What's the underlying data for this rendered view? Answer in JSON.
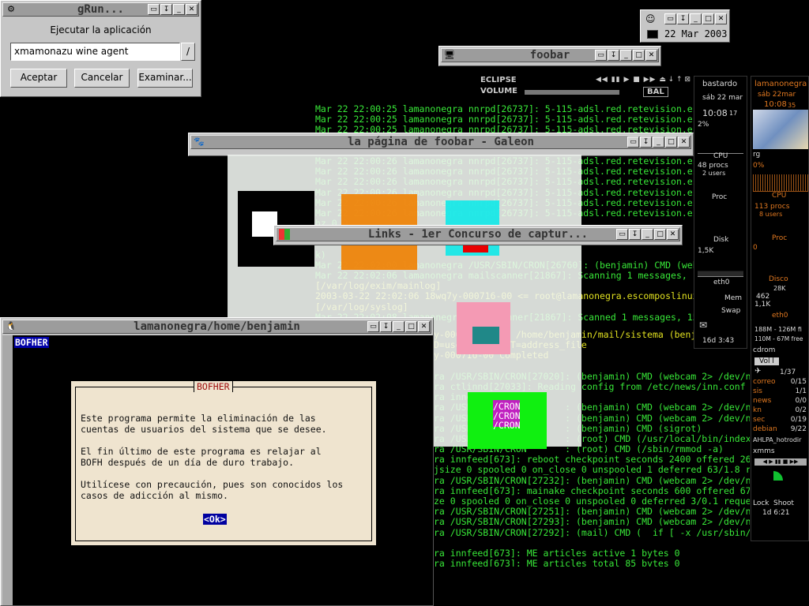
{
  "grun": {
    "title": "gRun...",
    "heading": "Ejecutar la aplicación",
    "input_value": "xmamonazu wine agent",
    "buttons": [
      "Aceptar",
      "Cancelar",
      "Examinar..."
    ]
  },
  "clock_win": {
    "date": "22 Mar 2003"
  },
  "foobar_win": {
    "title": "foobar",
    "player_name": "ECLIPSE",
    "volume_label": "VOLUME",
    "balance_label": "BAL"
  },
  "galeon_win": {
    "title": "la página de foobar - Galeon"
  },
  "links_win": {
    "title": "Links - 1er Concurso de captur..."
  },
  "term_win": {
    "title": "lamanonegra/home/benjamin",
    "program": "BOFHER",
    "dialog": {
      "title": "BOFHER",
      "lines": [
        "Este programa permite la eliminación de las",
        "cuentas de usuarios del sistema que se desee.",
        "",
        "El fin último de este programa es relajar al",
        "BOFH después de un día de duro trabajo.",
        "",
        "Utilícese con precaución, pues son conocidos los",
        "casos de adicción al mismo."
      ],
      "ok_label": "<Ok>"
    }
  },
  "log_lines": [
    {
      "text": "Mar 22 22:00:25 lamanonegra nnrpd[26737]: 5-115-adsl.red.retevision.es group es.",
      "color": "#38e838"
    },
    {
      "text": "Mar 22 22:00:25 lamanonegra nnrpd[26737]: 5-115-adsl.red.retevision.es group es.",
      "color": "#38e838"
    },
    {
      "text": "Mar 22 22:00:25 lamanonegra nnrpd[26737]: 5-115-adsl.red.retevision.es group es.",
      "color": "#38e838"
    },
    {
      "text": "Mar 22 22:00:25 lamanonegra nnrpd[26737]: 5-115-adsl.red.retevision.es group es.",
      "color": "#38e838"
    },
    {
      "text": "",
      "color": "#38e838"
    },
    {
      "text": "Mar 22 22:00:26 lamanonegra nnrpd[26737]: 5-115-adsl.red.retevision.es group es.",
      "color": "#38e838"
    },
    {
      "text": "Mar 22 22:00:26 lamanonegra nnrpd[26737]: 5-115-adsl.red.retevision.es group eco",
      "color": "#38e838"
    },
    {
      "text": "Mar 22 22:00:26 lamanonegra nnrpd[26737]: 5-115-adsl.red.retevision.es exit arti",
      "color": "#38e838"
    },
    {
      "text": "Mar 22 22:00:26 lamanonegra nnrpd[26737]: 5-115-adsl.red.retevision.es times use",
      "color": "#38e838"
    },
    {
      "text": "Mar 22 22:00:26 lamanonegra nnrpd[26737]: 5-115-adsl.red.retevision.es artstats",
      "color": "#38e838"
    },
    {
      "text": "Mar 22 22:00:26 lamanonegra nnrpd[26737]: 5-115-adsl.red.retevision.es overstats",
      "color": "#38e838"
    },
    {
      "text": "hz 0 0",
      "color": "#38e838"
    },
    {
      "text": "",
      "color": "#38e838"
    },
    {
      "text": "",
      "color": "#38e838"
    },
    {
      "text": "k)",
      "color": "#38e838"
    },
    {
      "text": "Mar 22 22:02:00 lamanonegra /USR/SBIN/CRON[26760]: (benjamin) CMD (webcam 2> /de",
      "color": "#38e838"
    },
    {
      "text": "Mar 22 22:02:06 lamanonegra mailscanner[21867]: Scanning 1 messages, 1579 bytes",
      "color": "#38e838"
    },
    {
      "text": "[/var/log/exim/mainlog]",
      "color": "#e0e020"
    },
    {
      "text": "2003-03-22 22:02:06 18wq7y-000716-00 <= root@lamanonegra.escomposlinux.org U=roo",
      "color": "#e0e020"
    },
    {
      "text": "[/var/log/syslog]",
      "color": "#e0e020"
    },
    {
      "text": "Mar 22 22:02:08 lamanonegra mailscanner[21867]: Scanned 1 messages, 1579 bytes i",
      "color": "#38e838"
    }
  ],
  "log_lines_lower": [
    {
      "text": "y-000716-00 => /home/benjamin/mail/sistema (benjamin@la",
      "color": "#e0e020"
    },
    {
      "text": "D=userforward T=address_file",
      "color": "#e0e020"
    },
    {
      "text": "y-000716-00 Completed",
      "color": "#e0e020"
    },
    {
      "text": "",
      "color": "#38e838"
    },
    {
      "text": "ra /USR/SBIN/CRON[27020]: (benjamin) CMD (webcam 2> /dev/null)",
      "color": "#38e838"
    },
    {
      "text": "ra ctlinnd[27033]: Reading config from /etc/news/inn.conf",
      "color": "#38e838"
    },
    {
      "text": "ra innd:",
      "color": "#38e838"
    },
    {
      "text": "ra /USR/                : (benjamin) CMD (webcam 2> /dev/null)",
      "color": "#38e838"
    },
    {
      "text": "ra /USR/                : (benjamin) CMD (webcam 2> /dev/null)",
      "color": "#38e838"
    },
    {
      "text": "ra /USR/                : (benjamin) CMD (sigrot)",
      "color": "#38e838"
    },
    {
      "text": "ra /USR/                : (root) CMD (/usr/local/bin/indexnews 1>/",
      "color": "#38e838"
    },
    {
      "text": "ra /USR/SBIN/CRON       : (root) CMD (/sbin/rmmod -a)",
      "color": "#38e838"
    },
    {
      "text": "ra innfeed[673]: reboot checkpoint seconds 2400 offered 261 accept",
      "color": "#38e838"
    },
    {
      "text": "jsize 0 spooled 0 on_close 0 unspooled 1 deferred 63/1.8 requeued",
      "color": "#38e838"
    },
    {
      "text": "ra /USR/SBIN/CRON[27232]: (benjamin) CMD (webcam 2> /dev/null)",
      "color": "#38e838"
    },
    {
      "text": "ra innfeed[673]: mainake checkpoint seconds 600 offered 67 accepte",
      "color": "#38e838"
    },
    {
      "text": "ze 0 spooled 0 on_close 0 unspooled 0 deferred 3/0.1 requeued 0 qu",
      "color": "#38e838"
    },
    {
      "text": "ra /USR/SBIN/CRON[27251]: (benjamin) CMD (webcam 2> /dev/null)",
      "color": "#38e838"
    },
    {
      "text": "ra /USR/SBIN/CRON[27293]: (benjamin) CMD (webcam 2> /dev/null)",
      "color": "#38e838"
    },
    {
      "text": "ra /USR/SBIN/CRON[27292]: (mail) CMD (  if [ -x /usr/sbin/exim -a -f /etc/exim/",
      "color": "#38e838"
    },
    {
      "text": "",
      "color": "#38e838"
    },
    {
      "text": "ra innfeed[673]: ME articles active 1 bytes 0",
      "color": "#38e838"
    },
    {
      "text": "ra innfeed[673]: ME articles total 85 bytes 0",
      "color": "#38e838"
    }
  ],
  "cron_labels": [
    "/CRON",
    "/CRON",
    "/CRON"
  ],
  "monitor1": {
    "host": "bastardo",
    "date": "sáb 22 mar",
    "time": "10:08",
    "time_sec": "17",
    "pct": "2%",
    "cpu_label": "CPU",
    "procs": "48 procs",
    "users": "2 users",
    "proc_label": "Proc",
    "disk_label": "Disk",
    "disk_val": "1,5K",
    "eth_label": "eth0",
    "mem_label": "Mem",
    "swap_label": "Swap",
    "uptime": "16d 3:43"
  },
  "monitor2": {
    "host": "lamanonegra",
    "date": "sáb 22mar",
    "time": "10:08",
    "time_sec": "35",
    "rg": "rg",
    "pct": "0%",
    "cpu_label": "CPU",
    "procs": "113 procs",
    "users": "8 users",
    "proc_label": "Proc",
    "proc_val": "0",
    "disco_label": "Disco",
    "disco_val": "28K",
    "net1": "462",
    "net2": "1,1K",
    "eth_label": "eth0",
    "mem": "188M - 126M fi",
    "mem2": "110M - 67M free",
    "cdrom": "cdrom",
    "vol": "Vol   l",
    "mail_count": "1/37",
    "mail_rows": [
      {
        "name": "correo",
        "val": "0/15"
      },
      {
        "name": "sis",
        "val": "1/1"
      },
      {
        "name": "news",
        "val": "0/0"
      },
      {
        "name": "kn",
        "val": "0/2"
      },
      {
        "name": "sec",
        "val": "0/19"
      },
      {
        "name": "debian",
        "val": "9/22"
      }
    ],
    "ahlpa": "AHLPA_hotrodir",
    "xmms": "xmms",
    "lock": "Lock",
    "shoot": "Shoot",
    "uptime": "1d 6:21"
  },
  "colors": {
    "log_green": "#38e838",
    "log_yellow": "#e0e020",
    "panel_orange": "#e07820",
    "panel_bg": "#000000"
  }
}
